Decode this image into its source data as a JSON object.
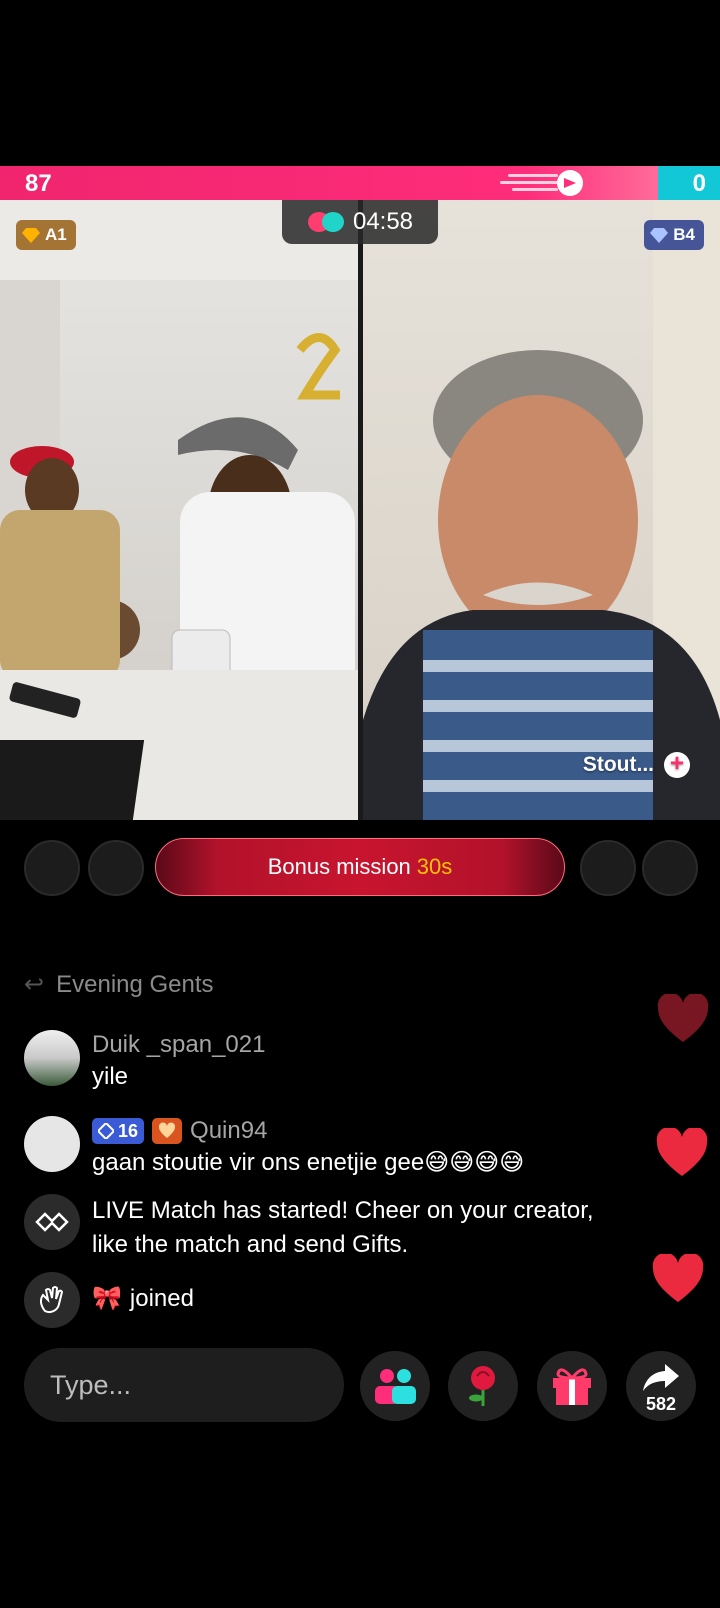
{
  "scores": {
    "left": "87",
    "right": "0"
  },
  "ranks": {
    "left": "A1",
    "right": "B4"
  },
  "timer": "04:58",
  "opponent_name": "Stout...",
  "bonus": {
    "label": "Bonus mission",
    "seconds": "30s"
  },
  "chat": {
    "faded_line": "Evening Gents",
    "messages": [
      {
        "user": "Duik _span_021",
        "text": "yile"
      },
      {
        "user": "Quin94",
        "level": "16",
        "text": "gaan stoutie vir ons enetjie gee😅😅😅😅"
      },
      {
        "user": "",
        "text": "LIVE Match has started! Cheer on your creator, like the match and send Gifts."
      },
      {
        "user": "",
        "text": "joined"
      }
    ]
  },
  "input": {
    "placeholder": "Type..."
  },
  "share_count": "582",
  "colors": {
    "pink": "#ff2d7a",
    "cyan": "#12c7d6",
    "heart": "#e8233a"
  }
}
